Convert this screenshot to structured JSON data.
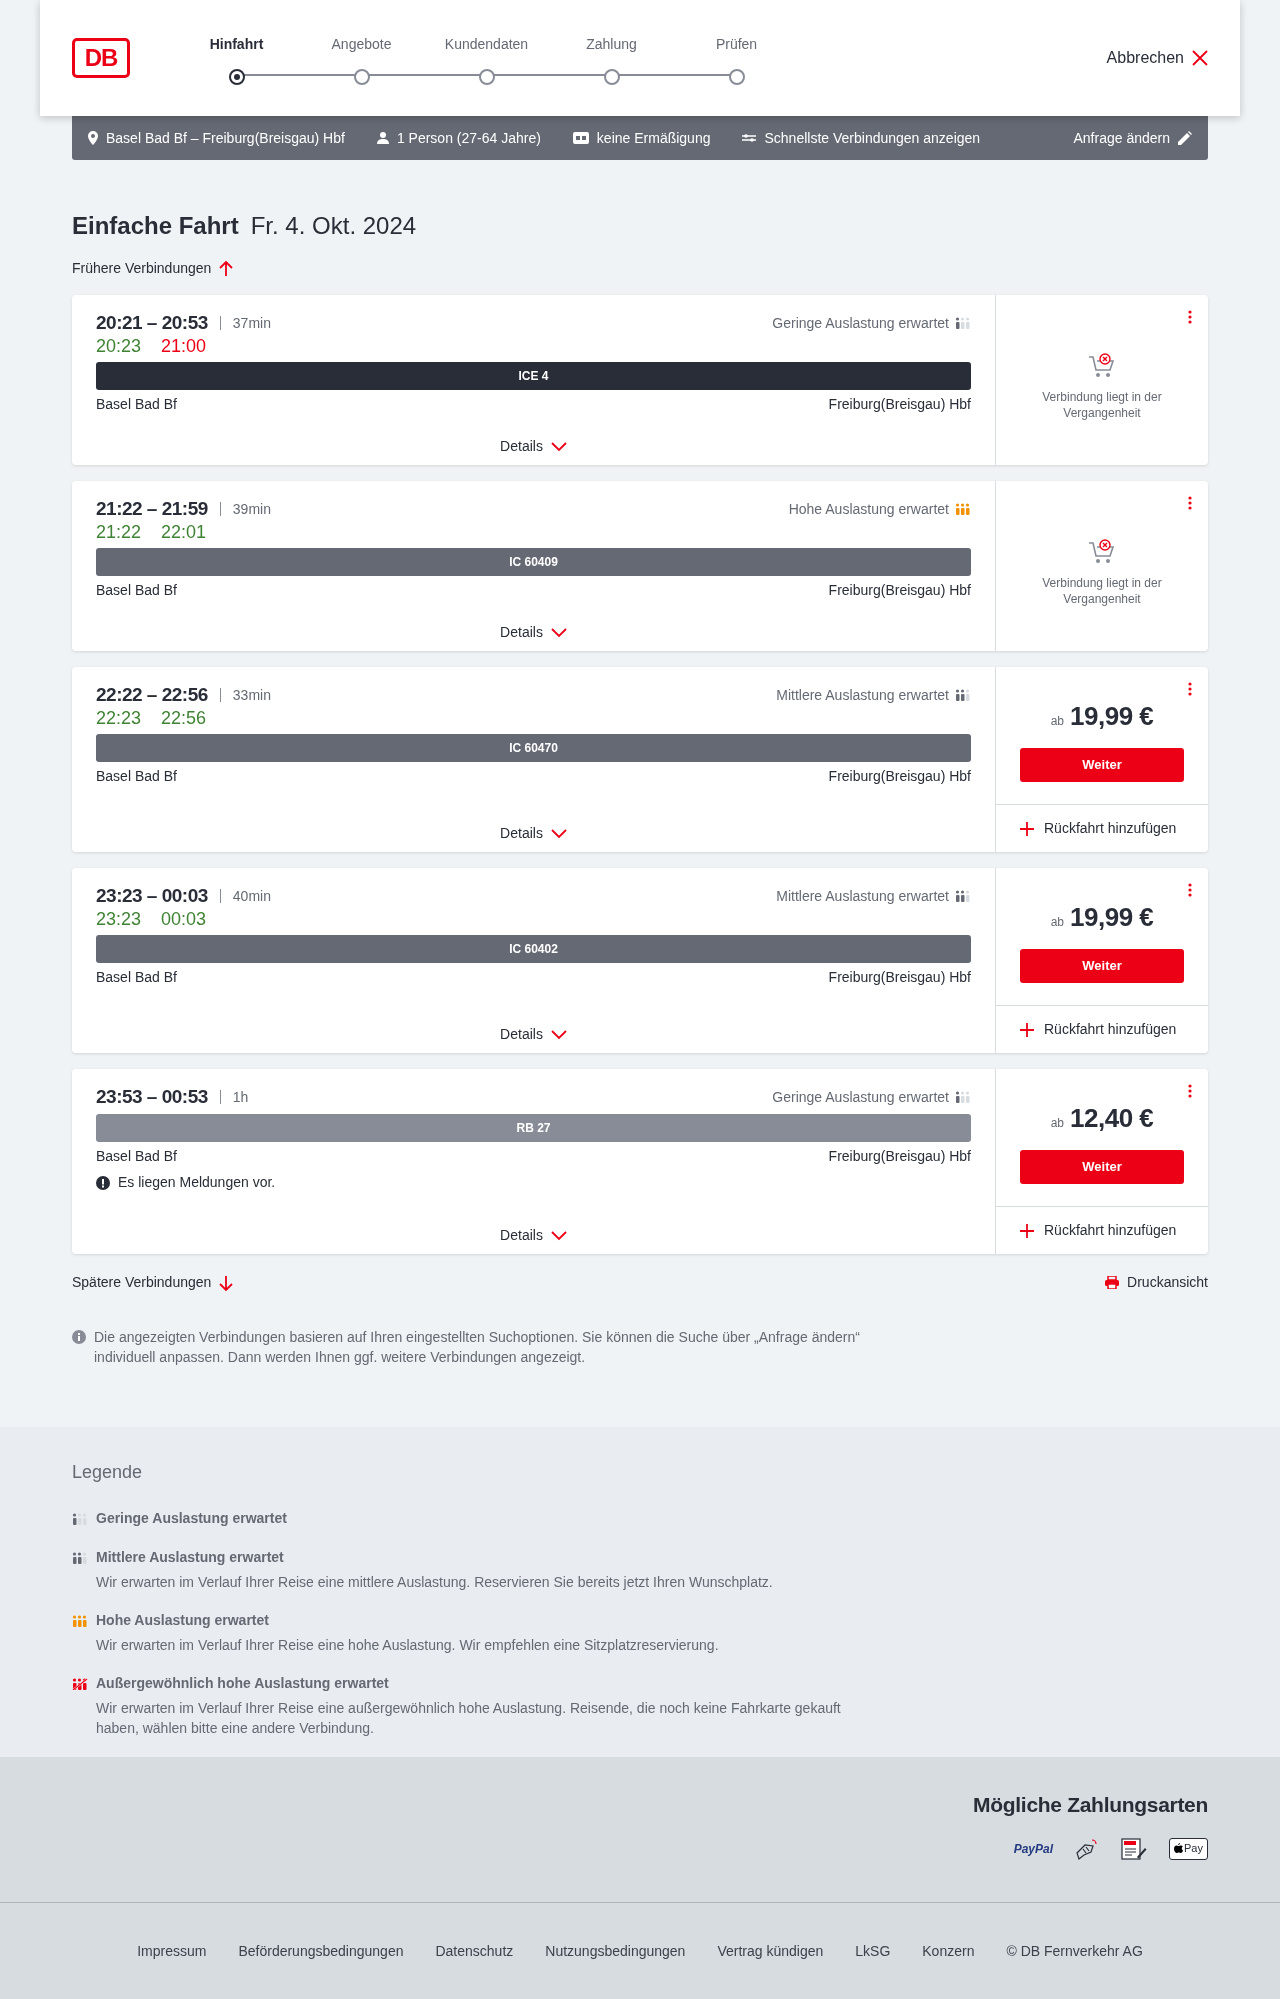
{
  "logo": "DB",
  "steps": [
    {
      "label": "Hinfahrt",
      "selected": true
    },
    {
      "label": "Angebote",
      "selected": false
    },
    {
      "label": "Kundendaten",
      "selected": false
    },
    {
      "label": "Zahlung",
      "selected": false
    },
    {
      "label": "Prüfen",
      "selected": false
    }
  ],
  "cancel": "Abbrechen",
  "summary": {
    "items": [
      {
        "kind": "route",
        "text": "Basel Bad Bf – Freiburg(Breisgau) Hbf"
      },
      {
        "kind": "person",
        "text": "1 Person (27-64 Jahre)"
      },
      {
        "kind": "card",
        "text": "keine Ermäßigung"
      },
      {
        "kind": "options",
        "text": "Schnellste Verbindungen anzeigen"
      }
    ],
    "edit": "Anfrage ändern"
  },
  "heading": {
    "title": "Einfache Fahrt",
    "date": "Fr. 4. Okt. 2024"
  },
  "earlier": "Frühere Verbindungen",
  "connections": [
    {
      "times": "20:21 – 20:53",
      "duration": "37min",
      "occupancy": {
        "kind": "low",
        "text": "Geringe Auslastung erwartet"
      },
      "realtime": [
        {
          "time": "20:23",
          "on_time": true
        },
        {
          "time": "21:00",
          "on_time": false
        }
      ],
      "train": {
        "kind": "ice",
        "name": "ICE 4"
      },
      "from": "Basel Bad Bf",
      "to": "Freiburg(Breisgau) Hbf",
      "details": "Details",
      "offer": {
        "kind": "past",
        "text": "Verbindung liegt in der Vergangenheit"
      }
    },
    {
      "times": "21:22 – 21:59",
      "duration": "39min",
      "occupancy": {
        "kind": "high",
        "text": "Hohe Auslastung erwartet"
      },
      "realtime": [
        {
          "time": "21:22",
          "on_time": true
        },
        {
          "time": "22:01",
          "on_time": true
        }
      ],
      "train": {
        "kind": "ic",
        "name": "IC 60409"
      },
      "from": "Basel Bad Bf",
      "to": "Freiburg(Breisgau) Hbf",
      "details": "Details",
      "offer": {
        "kind": "past",
        "text": "Verbindung liegt in der Vergangenheit"
      }
    },
    {
      "times": "22:22 – 22:56",
      "duration": "33min",
      "occupancy": {
        "kind": "medium",
        "text": "Mittlere Auslastung erwartet"
      },
      "realtime": [
        {
          "time": "22:23",
          "on_time": true
        },
        {
          "time": "22:56",
          "on_time": true
        }
      ],
      "train": {
        "kind": "ic",
        "name": "IC 60470"
      },
      "from": "Basel Bad Bf",
      "to": "Freiburg(Breisgau) Hbf",
      "details": "Details",
      "offer": {
        "kind": "price",
        "prefix": "ab",
        "price": "19,99 €",
        "button": "Weiter",
        "return": "Rückfahrt hinzufügen"
      }
    },
    {
      "times": "23:23 – 00:03",
      "duration": "40min",
      "occupancy": {
        "kind": "medium",
        "text": "Mittlere Auslastung erwartet"
      },
      "realtime": [
        {
          "time": "23:23",
          "on_time": true
        },
        {
          "time": "00:03",
          "on_time": true
        }
      ],
      "train": {
        "kind": "ic",
        "name": "IC 60402"
      },
      "from": "Basel Bad Bf",
      "to": "Freiburg(Breisgau) Hbf",
      "details": "Details",
      "offer": {
        "kind": "price",
        "prefix": "ab",
        "price": "19,99 €",
        "button": "Weiter",
        "return": "Rückfahrt hinzufügen"
      }
    },
    {
      "times": "23:53 – 00:53",
      "duration": "1h",
      "occupancy": {
        "kind": "low",
        "text": "Geringe Auslastung erwartet"
      },
      "train": {
        "kind": "rb",
        "name": "RB 27"
      },
      "from": "Basel Bad Bf",
      "to": "Freiburg(Breisgau) Hbf",
      "message": "Es liegen Meldungen vor.",
      "details": "Details",
      "offer": {
        "kind": "price",
        "prefix": "ab",
        "price": "12,40 €",
        "button": "Weiter",
        "return": "Rückfahrt hinzufügen"
      }
    }
  ],
  "later": "Spätere Verbindungen",
  "print": "Druckansicht",
  "info": "Die angezeigten Verbindungen basieren auf Ihren eingestellten Suchoptionen. Sie können die Suche über „Anfrage ändern“ individuell anpassen. Dann werden Ihnen ggf. weitere Verbindungen angezeigt.",
  "legend": {
    "title": "Legende",
    "items": [
      {
        "kind": "low",
        "title": "Geringe Auslastung erwartet"
      },
      {
        "kind": "medium",
        "title": "Mittlere Auslastung erwartet",
        "text": "Wir erwarten im Verlauf Ihrer Reise eine mittlere Auslastung. Reservieren Sie bereits jetzt Ihren Wunschplatz."
      },
      {
        "kind": "high",
        "title": "Hohe Auslastung erwartet",
        "text": "Wir erwarten im Verlauf Ihrer Reise eine hohe Auslastung. Wir empfehlen eine Sitzplatzreservierung."
      },
      {
        "kind": "extreme",
        "title": "Außergewöhnlich hohe Auslastung erwartet",
        "text": "Wir erwarten im Verlauf Ihrer Reise eine außergewöhnlich hohe Auslastung. Reisende, die noch keine Fahrkarte gekauft haben, wählen bitte eine andere Verbindung."
      }
    ]
  },
  "payment": {
    "title": "Mögliche Zahlungsarten",
    "methods": [
      {
        "kind": "paypal",
        "text": "PayPal"
      },
      {
        "kind": "card"
      },
      {
        "kind": "sepa"
      },
      {
        "kind": "applepay",
        "text": "Pay"
      }
    ]
  },
  "footer": [
    "Impressum",
    "Beförderungsbedingungen",
    "Datenschutz",
    "Nutzungsbedingungen",
    "Vertrag kündigen",
    "LkSG",
    "Konzern",
    "© DB Fernverkehr AG"
  ]
}
